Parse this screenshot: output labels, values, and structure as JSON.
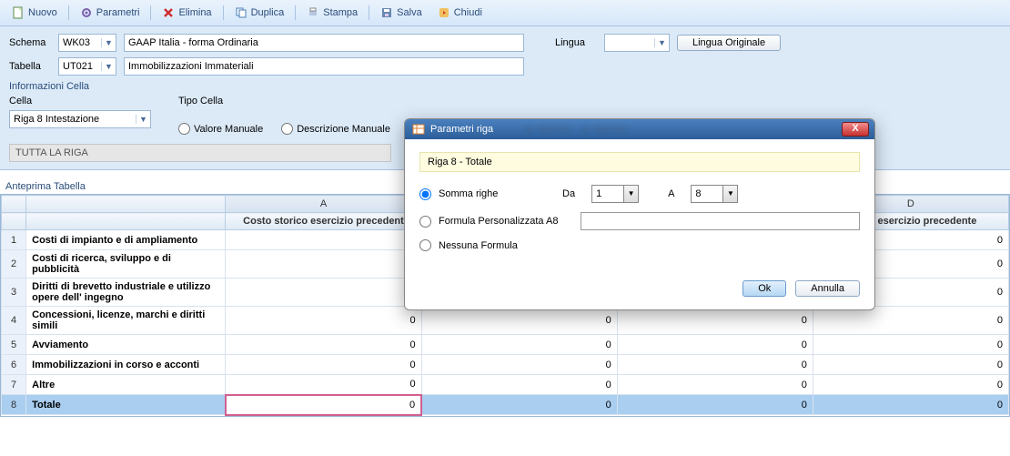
{
  "toolbar": {
    "new": "Nuovo",
    "params": "Parametri",
    "del": "Elimina",
    "dup": "Duplica",
    "print": "Stampa",
    "save": "Salva",
    "close": "Chiudi"
  },
  "form": {
    "schema_label": "Schema",
    "schema_code": "WK03",
    "schema_desc": "GAAP Italia - forma Ordinaria",
    "lingua_label": "Lingua",
    "lingua_value": "",
    "lingua_orig": "Lingua Originale",
    "tabella_label": "Tabella",
    "tabella_code": "UT021",
    "tabella_desc": "Immobilizzazioni Immateriali",
    "info_cella": "Informazioni Cella",
    "cella_label": "Cella",
    "cella_value": "Riga 8 Intestazione",
    "tipo_cella": "Tipo Cella",
    "valore_manuale": "Valore Manuale",
    "descr_manuale": "Descrizione Manuale",
    "tutta_riga": "TUTTA LA RIGA",
    "anteprima": "Anteprima Tabella"
  },
  "grid": {
    "col_letters": [
      "A",
      "D"
    ],
    "col_headers": [
      "Costo storico esercizio precedent",
      "mento esercizio precedente"
    ],
    "rows": [
      {
        "n": "1",
        "label": "Costi di impianto e di ampliamento",
        "a": "",
        "d": "0"
      },
      {
        "n": "2",
        "label": "Costi di ricerca, sviluppo e di pubblicità",
        "a": "",
        "d": "0"
      },
      {
        "n": "3",
        "label": "Diritti di brevetto industriale e utilizzo opere dell' ingegno",
        "a": "",
        "d": "0"
      },
      {
        "n": "4",
        "label": "Concessioni, licenze, marchi e diritti simili",
        "a": "0",
        "d": "0",
        "mid": [
          "0",
          "0"
        ]
      },
      {
        "n": "5",
        "label": "Avviamento",
        "a": "0",
        "d": "0",
        "mid": [
          "0",
          "0"
        ]
      },
      {
        "n": "6",
        "label": "Immobilizzazioni in corso e acconti",
        "a": "0",
        "d": "0",
        "mid": [
          "0",
          "0"
        ]
      },
      {
        "n": "7",
        "label": "Altre",
        "a": "0",
        "d": "0",
        "mid": [
          "0",
          "0"
        ]
      },
      {
        "n": "8",
        "label": "Totale",
        "a": "0",
        "d": "0",
        "mid": [
          "0",
          "0"
        ],
        "total": true
      }
    ]
  },
  "modal": {
    "title": "Parametri riga",
    "rowname": "Riga 8 - Totale",
    "opt_somma": "Somma righe",
    "da": "Da",
    "da_val": "1",
    "a": "A",
    "a_val": "8",
    "opt_formula": "Formula Personalizzata A8",
    "formula_val": "",
    "opt_nessuna": "Nessuna Formula",
    "ok": "Ok",
    "annulla": "Annulla"
  }
}
